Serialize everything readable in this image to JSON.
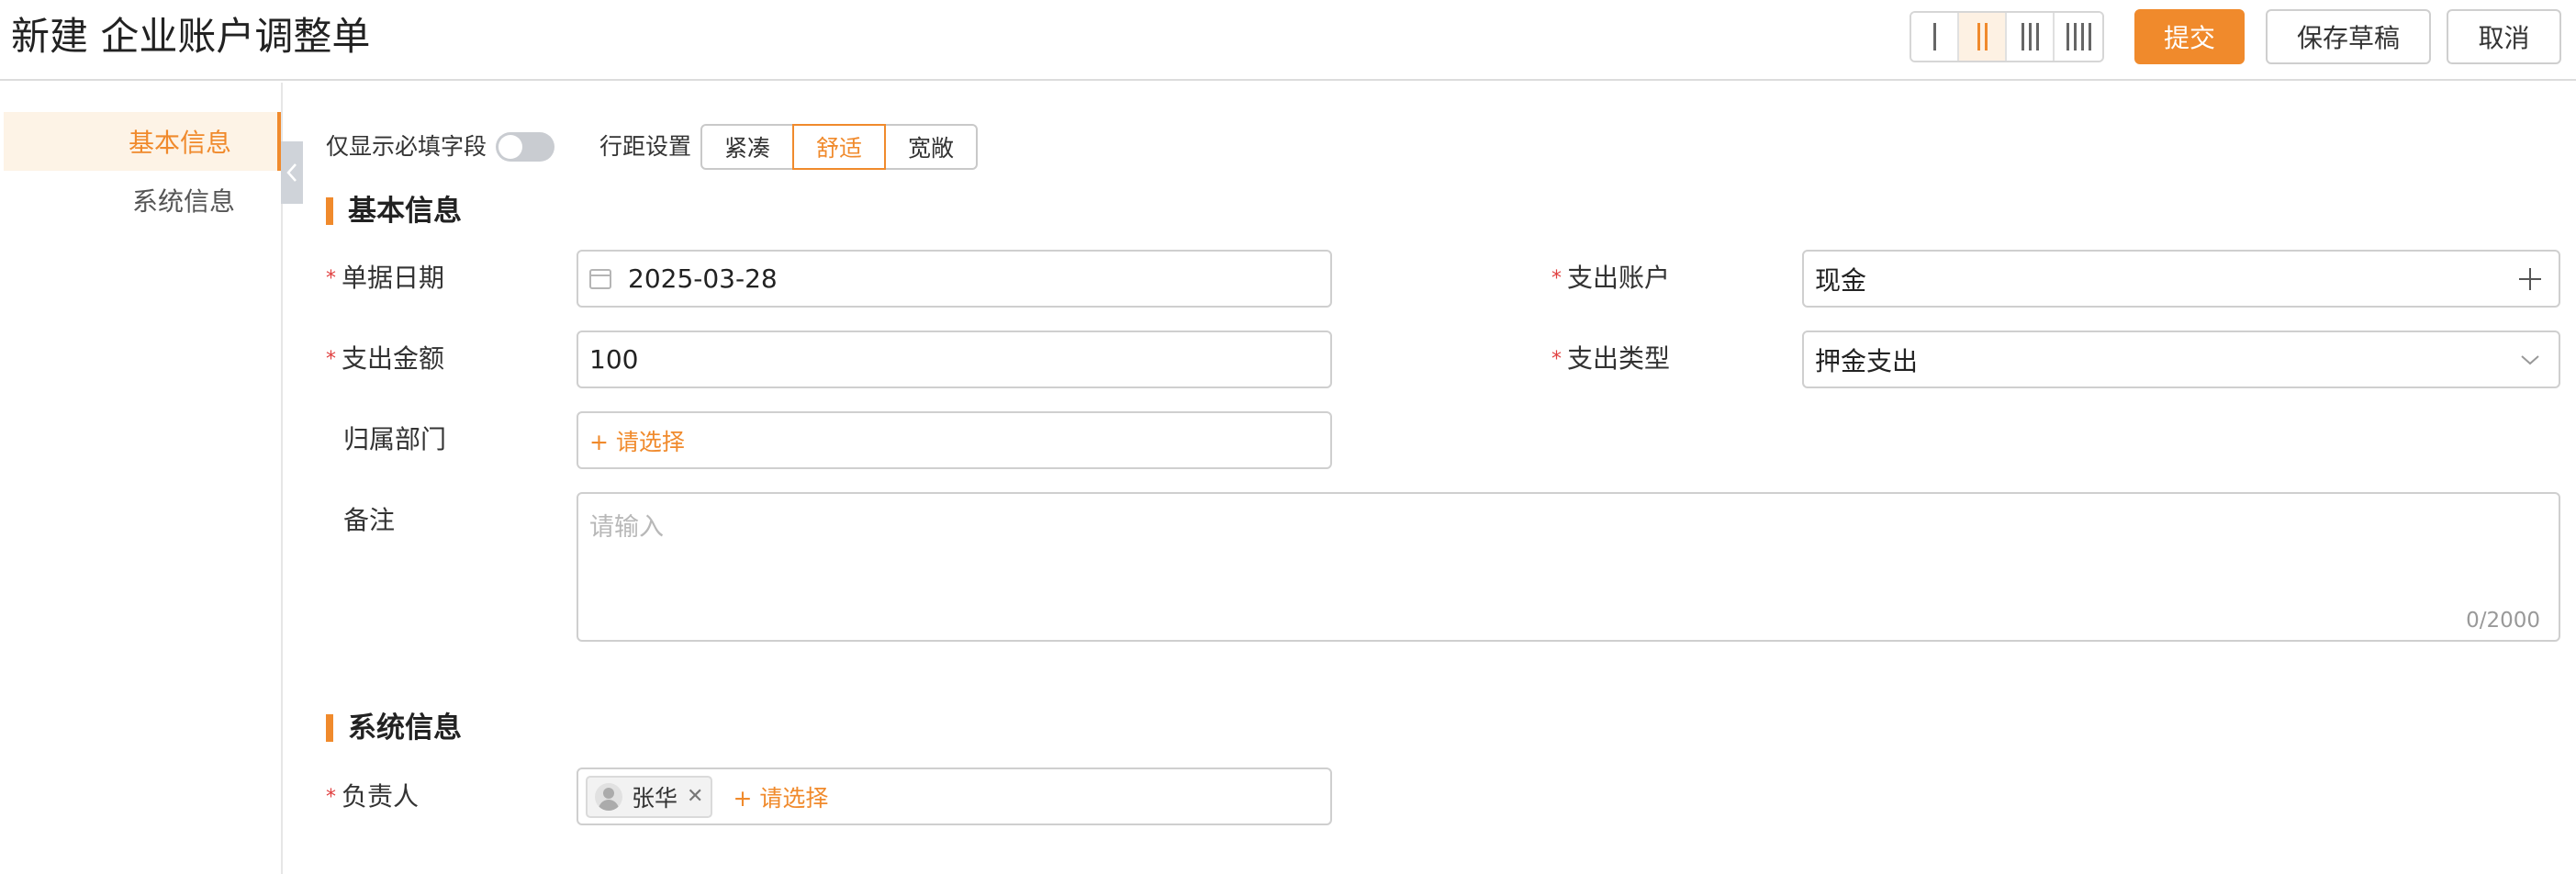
{
  "header": {
    "title": "新建 企业账户调整单",
    "column_options": [
      "one-column-icon",
      "two-column-icon",
      "three-column-icon",
      "four-column-icon"
    ],
    "submit_label": "提交",
    "draft_label": "保存草稿",
    "cancel_label": "取消"
  },
  "sidebar": {
    "items": [
      {
        "label": "基本信息",
        "active": true
      },
      {
        "label": "系统信息",
        "active": false
      }
    ]
  },
  "toolbar": {
    "required_only_label": "仅显示必填字段",
    "required_only_on": false,
    "spacing_label": "行距设置",
    "spacing_options": [
      {
        "label": "紧凑",
        "active": false
      },
      {
        "label": "舒适",
        "active": true
      },
      {
        "label": "宽敞",
        "active": false
      }
    ]
  },
  "basic": {
    "title": "基本信息",
    "date_label": "单据日期",
    "date_value": "2025-03-28",
    "account_label": "支出账户",
    "account_value": "现金",
    "amount_label": "支出金额",
    "amount_value": "100",
    "type_label": "支出类型",
    "type_value": "押金支出",
    "dept_label": "归属部门",
    "dept_placeholder": "+ 请选择",
    "remark_label": "备注",
    "remark_placeholder": "请输入",
    "remark_count": "0/2000"
  },
  "system": {
    "title": "系统信息",
    "owner_label": "负责人",
    "owner_tag": "张华",
    "owner_add": "+ 请选择"
  },
  "colors": {
    "accent": "#f08a2c",
    "required": "#e04040"
  }
}
